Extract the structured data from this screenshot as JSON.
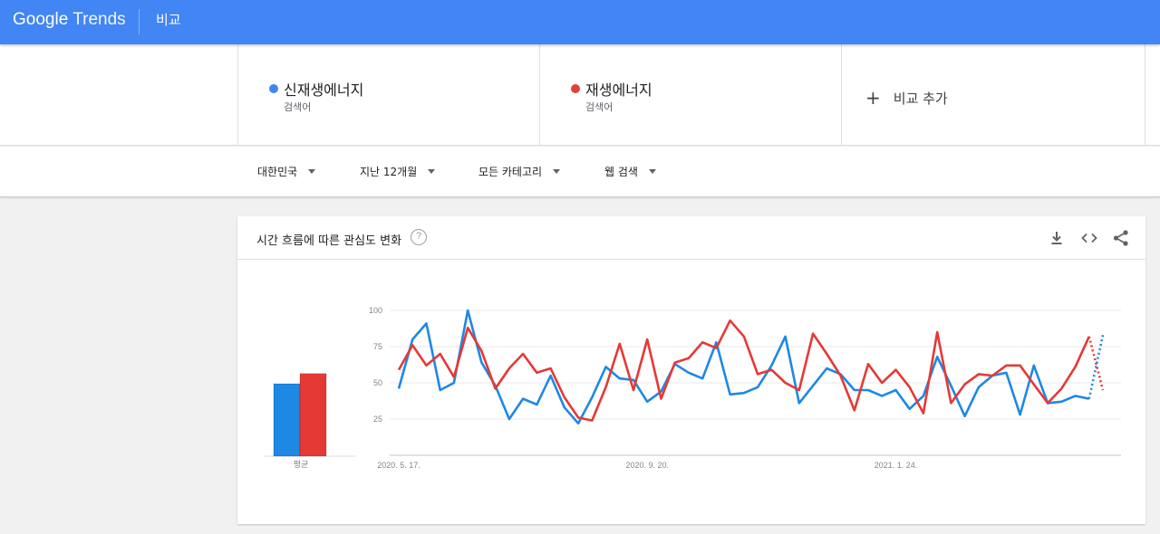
{
  "header": {
    "logo_google": "Google",
    "logo_trends": "Trends",
    "page_title": "비교"
  },
  "terms": [
    {
      "name": "신재생에너지",
      "type": "검색어",
      "color": "#4285f4"
    },
    {
      "name": "재생에너지",
      "type": "검색어",
      "color": "#db4437"
    }
  ],
  "add_term_label": "비교 추가",
  "filters": {
    "region": "대한민국",
    "period": "지난 12개월",
    "category": "모든 카테고리",
    "search_type": "웹 검색"
  },
  "card": {
    "title": "시간 흐름에 따른 관심도 변화",
    "help": "?",
    "tools": [
      "download-icon",
      "embed-icon",
      "share-icon"
    ]
  },
  "chart_data": [
    {
      "type": "bar",
      "categories": [
        "평균"
      ],
      "series": [
        {
          "name": "신재생에너지",
          "values": [
            50
          ],
          "color": "#1e88e5"
        },
        {
          "name": "재생에너지",
          "values": [
            57
          ],
          "color": "#e53935"
        }
      ],
      "ylim": [
        0,
        100
      ]
    },
    {
      "type": "line",
      "ylim": [
        0,
        100
      ],
      "y_ticks": [
        25,
        50,
        75,
        100
      ],
      "x_tick_labels": [
        "2020. 5. 17.",
        "2020. 9. 20.",
        "2021. 1. 24."
      ],
      "x_tick_index": [
        0,
        18,
        36
      ],
      "grid": true,
      "partial_last_point": true,
      "series": [
        {
          "name": "신재생에너지",
          "color": "#1e88e5",
          "values": [
            46,
            80,
            91,
            45,
            50,
            100,
            64,
            48,
            25,
            39,
            35,
            55,
            33,
            22,
            40,
            61,
            53,
            52,
            37,
            44,
            63,
            57,
            53,
            78,
            42,
            43,
            47,
            62,
            82,
            36,
            48,
            60,
            56,
            45,
            45,
            41,
            45,
            32,
            41,
            68,
            48,
            27,
            47,
            55,
            57,
            28,
            62,
            36,
            37,
            41,
            39,
            83
          ]
        },
        {
          "name": "재생에너지",
          "color": "#e53935",
          "values": [
            59,
            76,
            62,
            70,
            54,
            88,
            72,
            46,
            60,
            70,
            57,
            60,
            40,
            26,
            24,
            47,
            77,
            45,
            80,
            39,
            64,
            67,
            78,
            74,
            93,
            82,
            56,
            59,
            50,
            45,
            84,
            70,
            55,
            31,
            63,
            50,
            59,
            47,
            29,
            85,
            36,
            49,
            56,
            55,
            62,
            62,
            49,
            36,
            46,
            61,
            82,
            45
          ]
        }
      ]
    }
  ]
}
